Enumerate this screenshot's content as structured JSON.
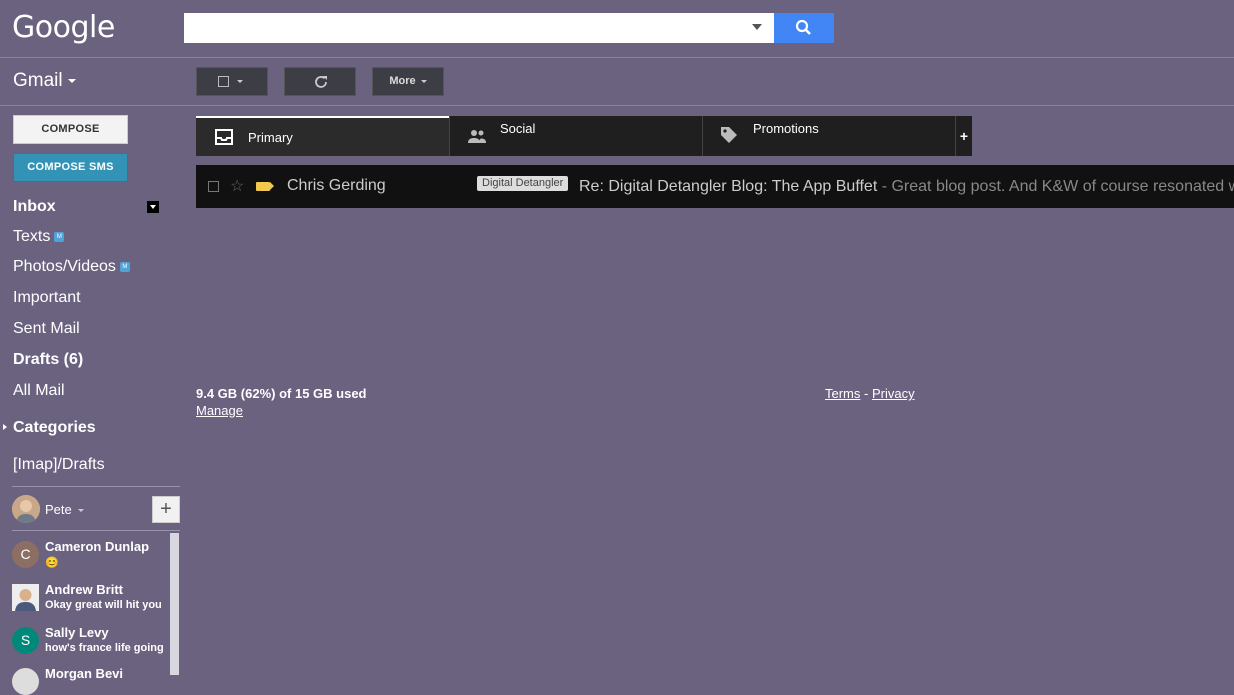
{
  "header": {
    "logo": "Google",
    "search": {
      "value": "",
      "placeholder": ""
    }
  },
  "app": {
    "name": "Gmail"
  },
  "toolbar": {
    "more_label": "More"
  },
  "compose": {
    "label": "COMPOSE",
    "sms_label": "COMPOSE SMS"
  },
  "nav": {
    "inbox": "Inbox",
    "texts": "Texts",
    "photos": "Photos/Videos",
    "important": "Important",
    "sent": "Sent Mail",
    "drafts": "Drafts (6)",
    "all": "All Mail",
    "categories": "Categories",
    "imap_drafts": "[Imap]/Drafts",
    "badge": "M"
  },
  "chat": {
    "me": "Pete",
    "add_label": "+",
    "contacts": [
      {
        "initial": "C",
        "name": "Cameron Dunlap",
        "status": "😊",
        "color": "#8d6e63"
      },
      {
        "initial": "",
        "name": "Andrew Britt",
        "status": "Okay great will hit you",
        "color": "#b08a6a"
      },
      {
        "initial": "S",
        "name": "Sally Levy",
        "status": "how's france life going",
        "color": "#00897b"
      },
      {
        "initial": "",
        "name": "Morgan Bevi",
        "status": "",
        "color": "#ddd"
      }
    ]
  },
  "tabs": {
    "primary": "Primary",
    "social": "Social",
    "promotions": "Promotions",
    "add": "+"
  },
  "emails": [
    {
      "sender": "Chris Gerding",
      "label": "Digital Detangler",
      "subject": "Re: Digital Detangler Blog: The App Buffet",
      "snippet": " - Great blog post. And K&W of course resonated w"
    }
  ],
  "footer": {
    "storage": "9.4 GB (62%) of 15 GB used",
    "manage": "Manage",
    "terms": "Terms",
    "sep": " - ",
    "privacy": "Privacy"
  },
  "colors": {
    "background": "#6b6280",
    "search_button": "#4285f4",
    "compose_sms": "#3393b6",
    "label_yellow": "#f2c94c"
  }
}
